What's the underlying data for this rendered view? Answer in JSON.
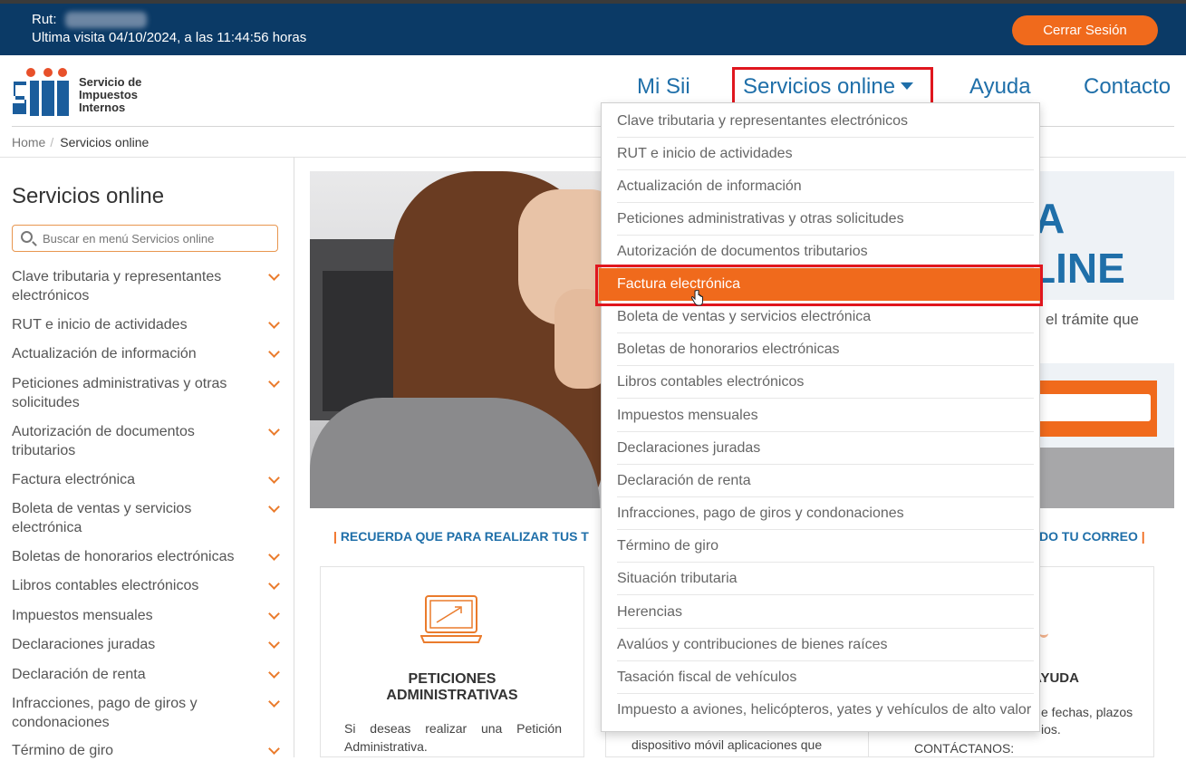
{
  "topbar": {
    "rut_label": "Rut:",
    "last_visit": "Ultima visita 04/10/2024, a las 11:44:56 horas",
    "logout_label": "Cerrar Sesión"
  },
  "logo": {
    "line1": "Servicio de",
    "line2": "Impuestos",
    "line3": "Internos"
  },
  "nav": {
    "items": [
      "Mi Sii",
      "Servicios online",
      "Ayuda",
      "Contacto"
    ]
  },
  "breadcrumb": {
    "home": "Home",
    "current": "Servicios online"
  },
  "sidebar": {
    "title": "Servicios online",
    "search_placeholder": "Buscar en menú Servicios online",
    "items": [
      "Clave tributaria y representantes electrónicos",
      "RUT e inicio de actividades",
      "Actualización de información",
      "Peticiones administrativas y otras solicitudes",
      "Autorización de documentos tributarios",
      "Factura electrónica",
      "Boleta de ventas y servicios electrónica",
      "Boletas de honorarios electrónicas",
      "Libros contables electrónicos",
      "Impuestos mensuales",
      "Declaraciones juradas",
      "Declaración de renta",
      "Infracciones, pago de giros y condonaciones",
      "Término de giro"
    ]
  },
  "hero": {
    "big_a": "A",
    "big_line": "LINE",
    "note": "el trámite que"
  },
  "notice": {
    "left": "RECUERDA QUE PARA REALIZAR TUS T",
    "right": "DO TU CORREO"
  },
  "cards": {
    "c1_title_1": "PETICIONES",
    "c1_title_2": "ADMINISTRATIVAS",
    "c1_text": "Si deseas realizar una Petición Administrativa.",
    "c2_text": "dispositivo móvil aplicaciones que",
    "c3_title": "AYUDA",
    "c3_t1": "e fechas, plazos",
    "c3_t2": "ios.",
    "c3_t3": "CONTÁCTANOS:"
  },
  "dropdown": {
    "items": [
      "Clave tributaria y representantes electrónicos",
      "RUT e inicio de actividades",
      "Actualización de información",
      "Peticiones administrativas y otras solicitudes",
      "Autorización de documentos tributarios",
      "Factura electrónica",
      "Boleta de ventas y servicios electrónica",
      "Boletas de honorarios electrónicas",
      "Libros contables electrónicos",
      "Impuestos mensuales",
      "Declaraciones juradas",
      "Declaración de renta",
      "Infracciones, pago de giros y condonaciones",
      "Término de giro",
      "Situación tributaria",
      "Herencias",
      "Avalúos y contribuciones de bienes raíces",
      "Tasación fiscal de vehículos",
      "Impuesto a aviones, helicópteros, yates y vehículos de alto valor"
    ],
    "active_index": 5
  },
  "colors": {
    "topbar": "#0b3a66",
    "accent": "#f06a1c",
    "link": "#1f6fa9",
    "highlight_border": "#e0161e"
  }
}
